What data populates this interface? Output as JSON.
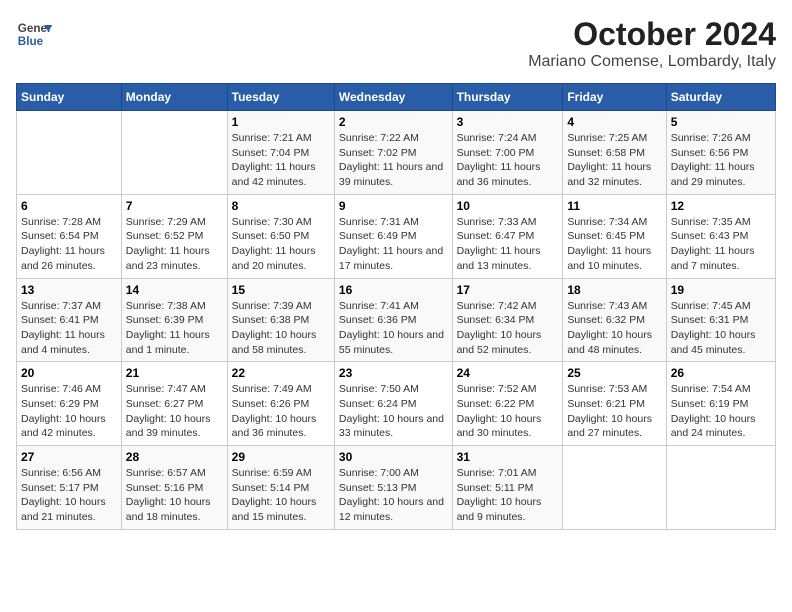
{
  "logo": {
    "line1": "General",
    "line2": "Blue"
  },
  "title": "October 2024",
  "subtitle": "Mariano Comense, Lombardy, Italy",
  "days_of_week": [
    "Sunday",
    "Monday",
    "Tuesday",
    "Wednesday",
    "Thursday",
    "Friday",
    "Saturday"
  ],
  "weeks": [
    [
      {
        "day": "",
        "sunrise": "",
        "sunset": "",
        "daylight": ""
      },
      {
        "day": "",
        "sunrise": "",
        "sunset": "",
        "daylight": ""
      },
      {
        "day": "1",
        "sunrise": "Sunrise: 7:21 AM",
        "sunset": "Sunset: 7:04 PM",
        "daylight": "Daylight: 11 hours and 42 minutes."
      },
      {
        "day": "2",
        "sunrise": "Sunrise: 7:22 AM",
        "sunset": "Sunset: 7:02 PM",
        "daylight": "Daylight: 11 hours and 39 minutes."
      },
      {
        "day": "3",
        "sunrise": "Sunrise: 7:24 AM",
        "sunset": "Sunset: 7:00 PM",
        "daylight": "Daylight: 11 hours and 36 minutes."
      },
      {
        "day": "4",
        "sunrise": "Sunrise: 7:25 AM",
        "sunset": "Sunset: 6:58 PM",
        "daylight": "Daylight: 11 hours and 32 minutes."
      },
      {
        "day": "5",
        "sunrise": "Sunrise: 7:26 AM",
        "sunset": "Sunset: 6:56 PM",
        "daylight": "Daylight: 11 hours and 29 minutes."
      }
    ],
    [
      {
        "day": "6",
        "sunrise": "Sunrise: 7:28 AM",
        "sunset": "Sunset: 6:54 PM",
        "daylight": "Daylight: 11 hours and 26 minutes."
      },
      {
        "day": "7",
        "sunrise": "Sunrise: 7:29 AM",
        "sunset": "Sunset: 6:52 PM",
        "daylight": "Daylight: 11 hours and 23 minutes."
      },
      {
        "day": "8",
        "sunrise": "Sunrise: 7:30 AM",
        "sunset": "Sunset: 6:50 PM",
        "daylight": "Daylight: 11 hours and 20 minutes."
      },
      {
        "day": "9",
        "sunrise": "Sunrise: 7:31 AM",
        "sunset": "Sunset: 6:49 PM",
        "daylight": "Daylight: 11 hours and 17 minutes."
      },
      {
        "day": "10",
        "sunrise": "Sunrise: 7:33 AM",
        "sunset": "Sunset: 6:47 PM",
        "daylight": "Daylight: 11 hours and 13 minutes."
      },
      {
        "day": "11",
        "sunrise": "Sunrise: 7:34 AM",
        "sunset": "Sunset: 6:45 PM",
        "daylight": "Daylight: 11 hours and 10 minutes."
      },
      {
        "day": "12",
        "sunrise": "Sunrise: 7:35 AM",
        "sunset": "Sunset: 6:43 PM",
        "daylight": "Daylight: 11 hours and 7 minutes."
      }
    ],
    [
      {
        "day": "13",
        "sunrise": "Sunrise: 7:37 AM",
        "sunset": "Sunset: 6:41 PM",
        "daylight": "Daylight: 11 hours and 4 minutes."
      },
      {
        "day": "14",
        "sunrise": "Sunrise: 7:38 AM",
        "sunset": "Sunset: 6:39 PM",
        "daylight": "Daylight: 11 hours and 1 minute."
      },
      {
        "day": "15",
        "sunrise": "Sunrise: 7:39 AM",
        "sunset": "Sunset: 6:38 PM",
        "daylight": "Daylight: 10 hours and 58 minutes."
      },
      {
        "day": "16",
        "sunrise": "Sunrise: 7:41 AM",
        "sunset": "Sunset: 6:36 PM",
        "daylight": "Daylight: 10 hours and 55 minutes."
      },
      {
        "day": "17",
        "sunrise": "Sunrise: 7:42 AM",
        "sunset": "Sunset: 6:34 PM",
        "daylight": "Daylight: 10 hours and 52 minutes."
      },
      {
        "day": "18",
        "sunrise": "Sunrise: 7:43 AM",
        "sunset": "Sunset: 6:32 PM",
        "daylight": "Daylight: 10 hours and 48 minutes."
      },
      {
        "day": "19",
        "sunrise": "Sunrise: 7:45 AM",
        "sunset": "Sunset: 6:31 PM",
        "daylight": "Daylight: 10 hours and 45 minutes."
      }
    ],
    [
      {
        "day": "20",
        "sunrise": "Sunrise: 7:46 AM",
        "sunset": "Sunset: 6:29 PM",
        "daylight": "Daylight: 10 hours and 42 minutes."
      },
      {
        "day": "21",
        "sunrise": "Sunrise: 7:47 AM",
        "sunset": "Sunset: 6:27 PM",
        "daylight": "Daylight: 10 hours and 39 minutes."
      },
      {
        "day": "22",
        "sunrise": "Sunrise: 7:49 AM",
        "sunset": "Sunset: 6:26 PM",
        "daylight": "Daylight: 10 hours and 36 minutes."
      },
      {
        "day": "23",
        "sunrise": "Sunrise: 7:50 AM",
        "sunset": "Sunset: 6:24 PM",
        "daylight": "Daylight: 10 hours and 33 minutes."
      },
      {
        "day": "24",
        "sunrise": "Sunrise: 7:52 AM",
        "sunset": "Sunset: 6:22 PM",
        "daylight": "Daylight: 10 hours and 30 minutes."
      },
      {
        "day": "25",
        "sunrise": "Sunrise: 7:53 AM",
        "sunset": "Sunset: 6:21 PM",
        "daylight": "Daylight: 10 hours and 27 minutes."
      },
      {
        "day": "26",
        "sunrise": "Sunrise: 7:54 AM",
        "sunset": "Sunset: 6:19 PM",
        "daylight": "Daylight: 10 hours and 24 minutes."
      }
    ],
    [
      {
        "day": "27",
        "sunrise": "Sunrise: 6:56 AM",
        "sunset": "Sunset: 5:17 PM",
        "daylight": "Daylight: 10 hours and 21 minutes."
      },
      {
        "day": "28",
        "sunrise": "Sunrise: 6:57 AM",
        "sunset": "Sunset: 5:16 PM",
        "daylight": "Daylight: 10 hours and 18 minutes."
      },
      {
        "day": "29",
        "sunrise": "Sunrise: 6:59 AM",
        "sunset": "Sunset: 5:14 PM",
        "daylight": "Daylight: 10 hours and 15 minutes."
      },
      {
        "day": "30",
        "sunrise": "Sunrise: 7:00 AM",
        "sunset": "Sunset: 5:13 PM",
        "daylight": "Daylight: 10 hours and 12 minutes."
      },
      {
        "day": "31",
        "sunrise": "Sunrise: 7:01 AM",
        "sunset": "Sunset: 5:11 PM",
        "daylight": "Daylight: 10 hours and 9 minutes."
      },
      {
        "day": "",
        "sunrise": "",
        "sunset": "",
        "daylight": ""
      },
      {
        "day": "",
        "sunrise": "",
        "sunset": "",
        "daylight": ""
      }
    ]
  ]
}
